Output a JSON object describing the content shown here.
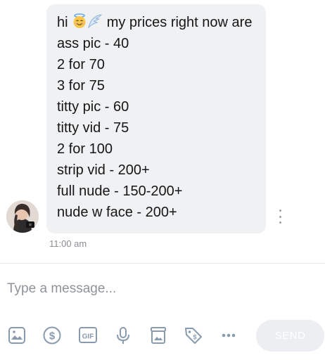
{
  "message": {
    "first_line_prefix": "hi",
    "first_line_emojis": [
      "smiling-face-with-halo-icon",
      "wing-icon"
    ],
    "first_line_suffix": "my prices right now are",
    "lines": [
      "ass pic - 40",
      "2 for 70",
      "3 for 75",
      "titty pic - 60",
      "titty vid - 75",
      "2 for 100",
      "strip vid - 200+",
      "full nude - 150-200+",
      "nude w face - 200+"
    ],
    "timestamp": "11:00 am"
  },
  "composer": {
    "placeholder": "Type a message..."
  },
  "toolbar": {
    "gif_label": "GIF",
    "send_label": "SEND",
    "tools": [
      "image-icon",
      "dollar-icon",
      "gif-icon",
      "microphone-icon",
      "vault-icon",
      "price-tag-icon",
      "more-icon"
    ]
  },
  "colors": {
    "bubble": "#f0f1f3",
    "icon": "#8a9bb0",
    "send_disabled": "#eceef1"
  }
}
